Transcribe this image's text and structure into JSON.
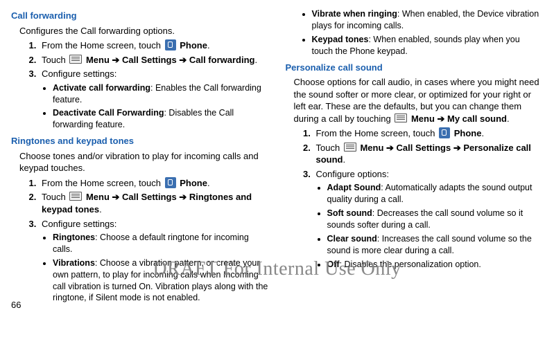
{
  "page_number": "66",
  "watermark": "DRAFT For Internal Use Only",
  "left": {
    "sec1": {
      "heading": "Call forwarding",
      "intro": "Configures the Call forwarding options.",
      "step1_a": "From the Home screen, touch ",
      "step1_b": "Phone",
      "step1_c": ".",
      "step2_a": "Touch ",
      "step2_b": "Menu ➔ Call Settings ➔ Call forwarding",
      "step2_c": ".",
      "step3": "Configure settings:",
      "b1_a": "Activate call forwarding",
      "b1_b": ": Enables the Call forwarding feature.",
      "b2_a": "Deactivate Call Forwarding",
      "b2_b": ": Disables the Call forwarding feature."
    },
    "sec2": {
      "heading": "Ringtones and keypad tones",
      "intro": "Choose tones and/or vibration to play for incoming calls and keypad touches.",
      "step1_a": "From the Home screen, touch ",
      "step1_b": "Phone",
      "step1_c": ".",
      "step2_a": "Touch ",
      "step2_b": "Menu ➔ Call Settings ➔ Ringtones and keypad tones",
      "step2_c": ".",
      "step3": "Configure settings:",
      "b1_a": "Ringtones",
      "b1_b": ": Choose a default ringtone for incoming calls.",
      "b2_a": "Vibrations",
      "b2_b": ": Choose a vibration pattern, or create your own pattern, to play for incoming calls when Incoming call vibration is turned On. Vibration plays along with the ringtone, if Silent mode is not enabled."
    }
  },
  "right": {
    "cont": {
      "b1_a": "Vibrate when ringing",
      "b1_b": ": When enabled, the Device vibration plays for incoming calls.",
      "b2_a": "Keypad tones",
      "b2_b": ": When enabled, sounds play when you touch the Phone keypad."
    },
    "sec": {
      "heading": "Personalize call sound",
      "intro_a": "Choose options for call audio, in cases where you might need the sound softer or more clear, or optimized for your right or left ear. These are the defaults, but you can change them during a call by touching ",
      "intro_b": "Menu ➔ My call sound",
      "intro_c": ".",
      "step1_a": "From the Home screen, touch ",
      "step1_b": "Phone",
      "step1_c": ".",
      "step2_a": "Touch ",
      "step2_b": "Menu ➔ Call Settings ➔ Personalize call sound",
      "step2_c": ".",
      "step3": "Configure options:",
      "b1_a": "Adapt Sound",
      "b1_b": ": Automatically adapts the sound output quality during a call.",
      "b2_a": "Soft sound",
      "b2_b": ": Decreases the call sound volume so it sounds softer during a call.",
      "b3_a": "Clear sound",
      "b3_b": ": Increases the call sound volume so the sound is more clear during a call.",
      "b4_a": "Off",
      "b4_b": ": Disables the personalization option."
    }
  }
}
